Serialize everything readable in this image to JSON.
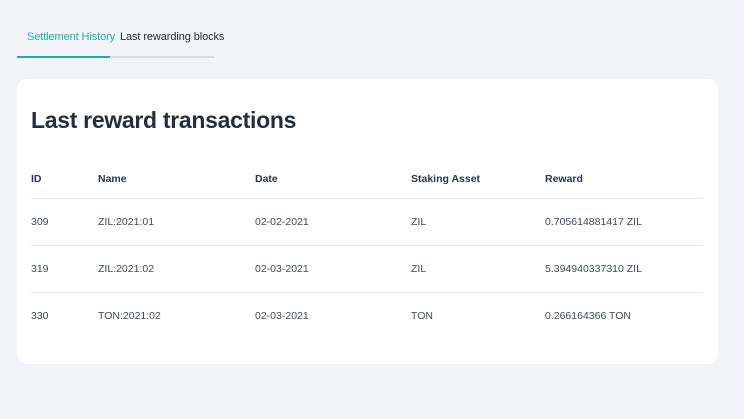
{
  "tabs": [
    {
      "label": "Settlement History",
      "active": true
    },
    {
      "label": "Last rewarding blocks",
      "active": false
    }
  ],
  "card": {
    "title": "Last reward transactions"
  },
  "table": {
    "columns": [
      "ID",
      "Name",
      "Date",
      "Staking Asset",
      "Reward"
    ],
    "rows": [
      {
        "id": "309",
        "name": "ZIL:2021:01",
        "date": "02-02-2021",
        "asset": "ZIL",
        "reward": "0.705614881417 ZIL"
      },
      {
        "id": "319",
        "name": "ZIL:2021:02",
        "date": "02-03-2021",
        "asset": "ZIL",
        "reward": "5.394940337310 ZIL"
      },
      {
        "id": "330",
        "name": "TON:2021:02",
        "date": "02-03-2021",
        "asset": "TON",
        "reward": "0.266164366 TON"
      }
    ]
  },
  "colors": {
    "accent": "#1eaca3",
    "background": "#f3f4f7",
    "card": "#ffffff"
  }
}
